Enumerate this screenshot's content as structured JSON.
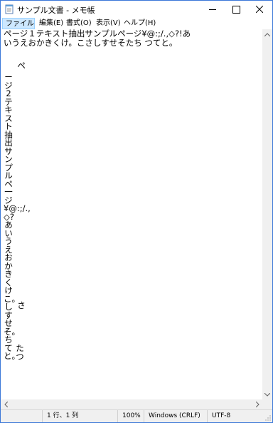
{
  "window": {
    "title": "サンプル文書 - メモ帳",
    "minimize_label": "—",
    "maximize_label": "□",
    "close_label": "✕"
  },
  "menu": {
    "file": "ファイル(F)",
    "edit": "編集(E)",
    "format": "書式(O)",
    "view": "表示(V)",
    "help": "ヘルプ(H)"
  },
  "document": {
    "line1": "ページ１テキスト抽出サンプルページ¥@:;/.,◇?!あ",
    "line2": "いうえおかきくけ。こさしすせそたち つてと。",
    "col_a": "ペ",
    "col_b": "ージ2テキスト抽出サンプルペ一ジ¥@:;/.,◇?あいうえおかきくけこ。しすせそ。ちてと。",
    "col_c": "さ",
    "col_d": "たつ"
  },
  "status": {
    "position": "1 行、1 列",
    "zoom": "100%",
    "line_ending": "Windows (CRLF)",
    "encoding": "UTF-8"
  },
  "colors": {
    "menu_highlight": "#cde8ff",
    "window_border": "#3c78d8",
    "chrome": "#f0f0f0"
  }
}
